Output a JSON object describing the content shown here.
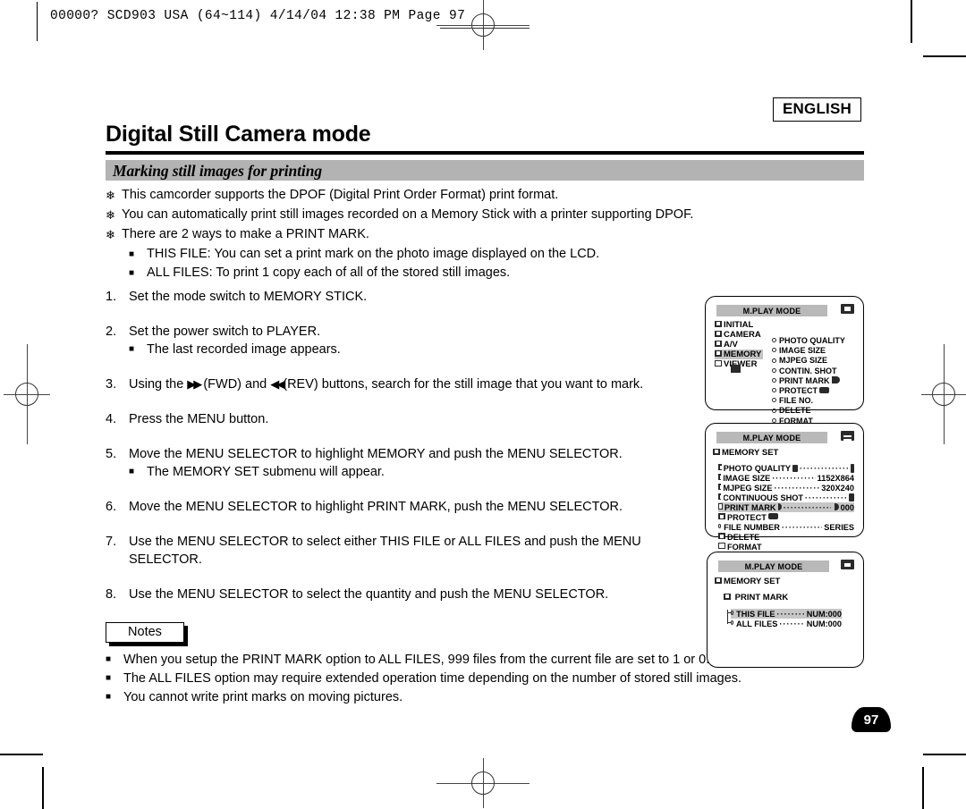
{
  "print_slug": "00000? SCD903 USA (64~114)  4/14/04 12:38 PM  Page 97",
  "header": {
    "language_badge": "ENGLISH",
    "page_title": "Digital Still Camera mode",
    "section_title": "Marking still images for printing"
  },
  "intro": {
    "bullets": [
      "This camcorder supports the DPOF (Digital Print Order Format) print format.",
      "You can automatically print still images recorded on a Memory Stick with a printer supporting DPOF.",
      "There are 2 ways to make a PRINT MARK."
    ],
    "sub_bullets": [
      "THIS FILE: You can set a print mark on the photo image displayed on the LCD.",
      "ALL FILES: To print 1 copy each of all of the stored still images."
    ]
  },
  "steps": [
    {
      "num": "1.",
      "text": "Set the mode switch to MEMORY STICK.",
      "subs": []
    },
    {
      "num": "2.",
      "text": "Set the power switch to PLAYER.",
      "subs": [
        "The last recorded image appears."
      ]
    },
    {
      "num": "3.",
      "text_before": "Using the ",
      "fwd": "(FWD) and ",
      "rev": "(REV) buttons, search for the still image that you want to mark.",
      "subs": []
    },
    {
      "num": "4.",
      "text": "Press the MENU button.",
      "subs": []
    },
    {
      "num": "5.",
      "text": "Move the MENU SELECTOR to highlight MEMORY and push the MENU SELECTOR.",
      "subs": [
        "The MEMORY SET submenu will appear."
      ]
    },
    {
      "num": "6.",
      "text": "Move the MENU SELECTOR to highlight PRINT MARK, push the MENU SELECTOR.",
      "subs": []
    },
    {
      "num": "7.",
      "text": "Use the MENU SELECTOR to select either THIS FILE or ALL FILES and push the MENU SELECTOR.",
      "subs": []
    },
    {
      "num": "8.",
      "text": "Use the MENU SELECTOR to select the quantity and push the MENU SELECTOR.",
      "subs": []
    }
  ],
  "notes": {
    "label": "Notes",
    "items": [
      "When you setup the PRINT MARK option to ALL FILES, 999 files from the current file are set to 1 or 0.",
      "The ALL FILES option may require extended operation time depending on the number of stored still images.",
      "You cannot write print marks on moving pictures."
    ]
  },
  "page_number": "97",
  "screens": {
    "screen1": {
      "title": "M.PLAY  MODE",
      "badge_icon": "memory-card-icon",
      "left_menu": [
        {
          "label": "INITIAL",
          "icon": "folder-icon",
          "selected": false
        },
        {
          "label": "CAMERA",
          "icon": "folder-icon",
          "selected": false
        },
        {
          "label": "A/V",
          "icon": "folder-icon",
          "selected": false
        },
        {
          "label": "MEMORY",
          "icon": "folder-icon",
          "selected": true
        },
        {
          "label": "VIEWER",
          "icon": "folder-open-icon",
          "selected": false
        }
      ],
      "right_menu": [
        {
          "label": "PHOTO QUALITY",
          "icon": ""
        },
        {
          "label": "IMAGE SIZE",
          "icon": ""
        },
        {
          "label": "MJPEG SIZE",
          "icon": ""
        },
        {
          "label": "CONTIN. SHOT",
          "icon": ""
        },
        {
          "label": "PRINT MARK",
          "icon": "print-mark-icon"
        },
        {
          "label": "PROTECT",
          "icon": "protect-icon"
        },
        {
          "label": "FILE NO.",
          "icon": ""
        },
        {
          "label": "DELETE",
          "icon": ""
        },
        {
          "label": "FORMAT",
          "icon": ""
        }
      ]
    },
    "screen2": {
      "title": "M.PLAY  MODE",
      "badge_icon": "memory-card-icon",
      "heading": "MEMORY SET",
      "rows": [
        {
          "label": "PHOTO QUALITY",
          "value": "",
          "icon": "quality-icon",
          "value_icon": "battery-icon",
          "selected": false
        },
        {
          "label": "IMAGE SIZE",
          "value": "1152X864",
          "icon": "",
          "value_icon": "",
          "selected": false
        },
        {
          "label": "MJPEG SIZE",
          "value": "320X240",
          "icon": "",
          "value_icon": "",
          "selected": false
        },
        {
          "label": "CONTINUOUS SHOT",
          "value": "",
          "icon": "",
          "value_icon": "continuous-icon",
          "selected": false
        },
        {
          "label": "PRINT MARK",
          "value": "000",
          "icon": "print-mark-icon",
          "value_icon": "print-mark-icon",
          "selected": true
        },
        {
          "label": "PROTECT",
          "value": "",
          "icon": "protect-icon",
          "value_icon": "",
          "selected": false
        },
        {
          "label": "FILE NUMBER",
          "value": "SERIES",
          "icon": "",
          "value_icon": "",
          "selected": false
        },
        {
          "label": "DELETE",
          "value": "",
          "icon": "",
          "value_icon": "",
          "selected": false
        },
        {
          "label": "FORMAT",
          "value": "",
          "icon": "",
          "value_icon": "",
          "selected": false
        }
      ]
    },
    "screen3": {
      "title": "M.PLAY  MODE",
      "badge_icon": "photo-icon",
      "heading": "MEMORY SET",
      "subheading": "PRINT MARK",
      "rows": [
        {
          "label": "THIS FILE",
          "value": "NUM:000",
          "selected": true
        },
        {
          "label": "ALL FILES",
          "value": "NUM:000",
          "selected": false
        }
      ]
    }
  }
}
